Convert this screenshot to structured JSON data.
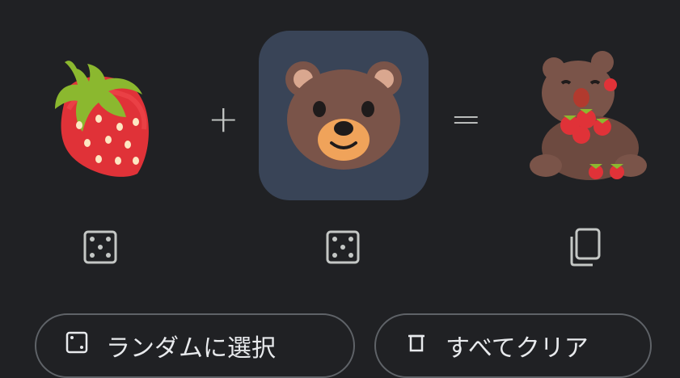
{
  "mixer": {
    "left_emoji": {
      "icon": "strawberry-emoji"
    },
    "right_emoji": {
      "icon": "bear-face-emoji",
      "selected": true
    },
    "result_emoji": {
      "icon": "bear-with-strawberries-emoji"
    },
    "plus_symbol": "+",
    "equals_symbol": "=",
    "left_action_icon": "dice-icon",
    "right_action_icon": "dice-icon",
    "result_action_icon": "copy-icon"
  },
  "actions": {
    "random_label": "ランダムに選択",
    "clear_label": "すべてクリア"
  },
  "colors": {
    "background": "#202124",
    "selected_background": "#394457",
    "icon": "#c4c7c5",
    "pill_border": "#5f6368"
  }
}
